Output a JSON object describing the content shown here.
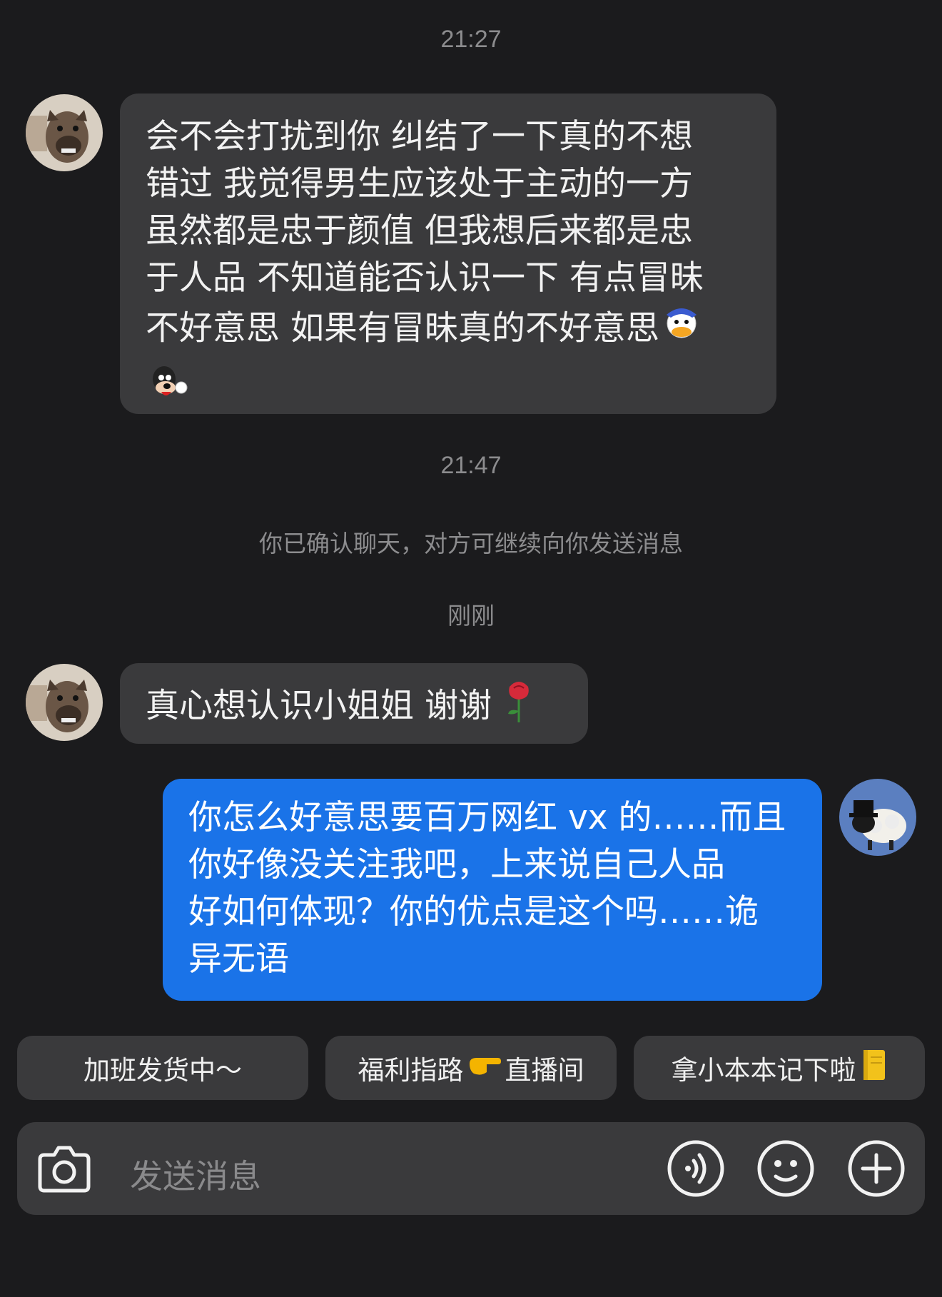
{
  "messages_area": {
    "time_1": "21:27",
    "time_2": "21:47",
    "system_notice": "你已确认聊天，对方可继续向你发送消息",
    "time_3": "刚刚",
    "incoming_1": {
      "lines": [
        "会不会打扰到你 纠结了一下真的不想",
        "错过 我觉得男生应该处于主动的一方",
        "虽然都是忠于颜值 但我想后来都是忠",
        "于人品 不知道能否认识一下 有点冒昧",
        "不好意思 如果有冒昧真的不好意思"
      ],
      "emojis": [
        "donald-duck-sticker",
        "goofy-sticker"
      ]
    },
    "incoming_2": {
      "text": "真心想认识小姐姐 谢谢",
      "emoji": "rose-emoji"
    },
    "outgoing_1": {
      "lines": [
        "你怎么好意思要百万网红 vx 的……而且",
        "你好像没关注我吧，上来说自己人品",
        "好如何体现？你的优点是这个吗……诡",
        "异无语"
      ]
    }
  },
  "quick_replies": [
    {
      "label": "加班发货中～"
    },
    {
      "label_a": "福利指路",
      "emoji": "pointing-hand-emoji",
      "label_b": "直播间"
    },
    {
      "label": "拿小本本记下啦",
      "emoji": "notebook-emoji"
    }
  ],
  "composer": {
    "placeholder": "发送消息",
    "icons": [
      "camera-icon",
      "voice-icon",
      "emoji-face-icon",
      "add-icon"
    ]
  },
  "colors": {
    "background": "#1b1b1d",
    "incoming_bubble": "#3a3a3c",
    "outgoing_bubble": "#1a73e8"
  }
}
